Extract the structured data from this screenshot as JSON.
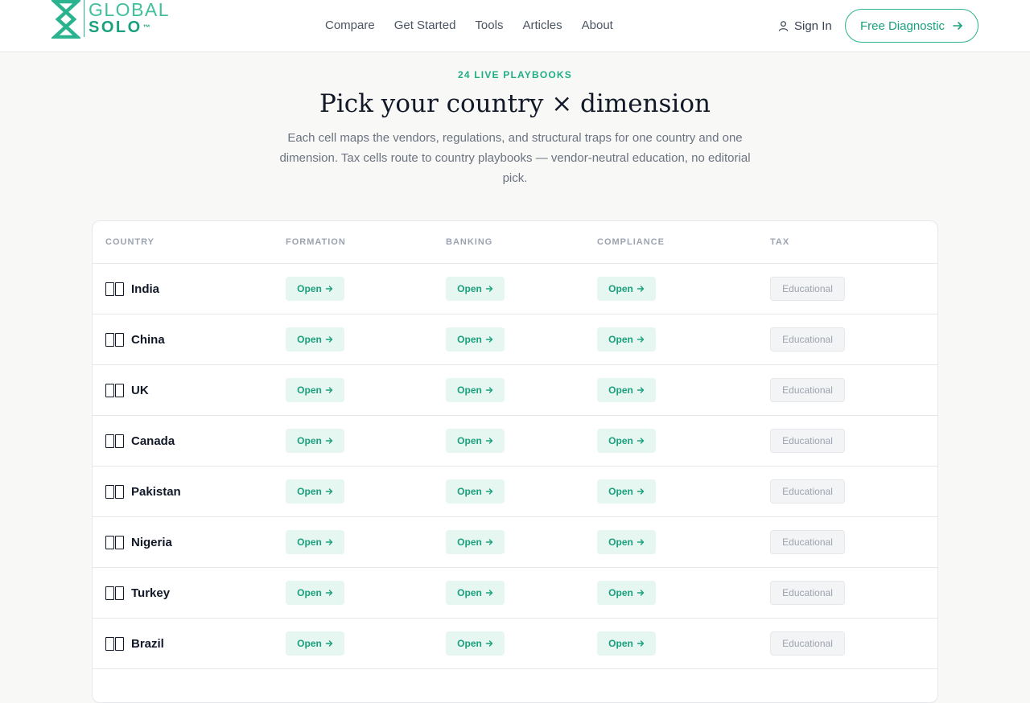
{
  "brand": {
    "word1": "GLOBAL",
    "word2": "SOLO",
    "tm": "™"
  },
  "nav": {
    "items": [
      "Compare",
      "Get Started",
      "Tools",
      "Articles",
      "About"
    ],
    "sign_in": "Sign In",
    "cta": "Free Diagnostic"
  },
  "hero": {
    "eyebrow": "24 LIVE PLAYBOOKS",
    "title": "Pick your country × dimension",
    "subtitle": "Each cell maps the vendors, regulations, and structural traps for one country and one dimension. Tax cells route to country playbooks — vendor-neutral education, no editorial pick."
  },
  "table": {
    "headers": [
      "COUNTRY",
      "FORMATION",
      "BANKING",
      "COMPLIANCE",
      "TAX"
    ],
    "open_label": "Open",
    "educational_label": "Educational",
    "rows": [
      {
        "country": "India"
      },
      {
        "country": "China"
      },
      {
        "country": "UK"
      },
      {
        "country": "Canada"
      },
      {
        "country": "Pakistan"
      },
      {
        "country": "Nigeria"
      },
      {
        "country": "Turkey"
      },
      {
        "country": "Brazil"
      }
    ]
  },
  "colors": {
    "accent": "#1aa07d",
    "accent_light": "#e6f6f0",
    "muted": "#9ca3af"
  }
}
